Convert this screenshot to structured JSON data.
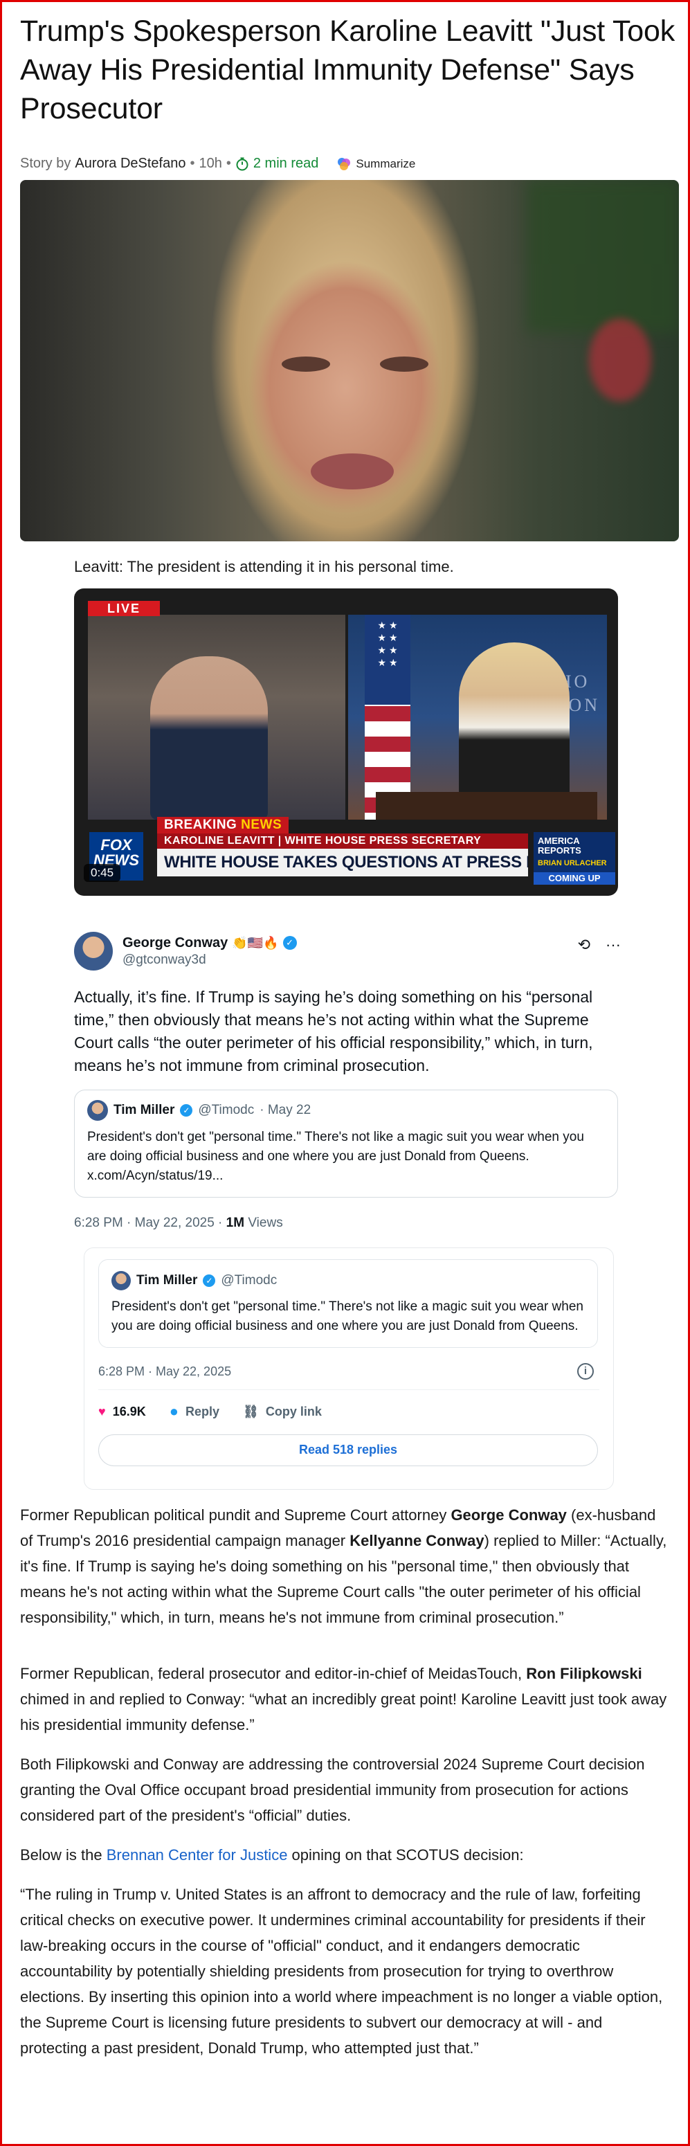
{
  "article": {
    "headline": "Trump's Spokesperson Karoline Leavitt \"Just Took Away His Presidential Immunity Defense\" Says Prosecutor",
    "byline_prefix": "Story by",
    "author": "Aurora DeStefano",
    "time_ago": "10h",
    "read_time": "2 min read",
    "summarize_label": "Summarize",
    "caption": "Leavitt: The president is attending it in his personal time."
  },
  "video": {
    "live_label": "LIVE",
    "network_logo": "FOX NEWS",
    "breaking_word1": "BREAKING",
    "breaking_word2": "NEWS",
    "name_bar": "KAROLINE LEAVITT | WHITE HOUSE PRESS SECRETARY",
    "headline_bar": "WHITE HOUSE TAKES QUESTIONS AT PRESS BRIEFING",
    "promo_title": "AMERICA REPORTS",
    "promo_name": "BRIAN URLACHER",
    "promo_coming": "COMING UP",
    "duration": "0:45",
    "wall_text": "TE HO\nNGTON"
  },
  "tweet": {
    "name": "George Conway",
    "emojis": "👏🇺🇸🔥",
    "handle": "@gtconway3d",
    "text": "Actually, it’s fine. If Trump is saying he’s doing something on his “personal time,” then obviously that means he’s not acting within what the Supreme Court calls “the outer perimeter of his official responsibility,” which, in turn, means he’s not immune from criminal prosecution.",
    "quote": {
      "name": "Tim Miller",
      "handle": "@Timodc",
      "date": "· May 22",
      "text": "President's don't get \"personal time.\" There's not like a magic suit you wear when you are doing official business and one where you are just Donald from Queens. x.com/Acyn/status/19..."
    },
    "time": "6:28 PM · May 22, 2025 · ",
    "views_count": "1M",
    "views_label": " Views"
  },
  "embed": {
    "name": "Tim Miller",
    "handle": "@Timodc",
    "text": "President's don't get \"personal time.\" There's not like a magic suit you wear when you are doing official business and one where you are just Donald from Queens.",
    "date": "6:28 PM · May 22, 2025",
    "likes": "16.9K",
    "reply_label": "Reply",
    "copy_label": "Copy link",
    "read_replies": "Read 518 replies"
  },
  "body": {
    "p1_a": "Former Republican political pundit and Supreme Court attorney ",
    "p1_b": "George Conway",
    "p1_c": " (ex-husband of Trump's 2016 presidential campaign manager ",
    "p1_d": "Kellyanne Conway",
    "p1_e": ") replied to Miller: “Actually, it's fine. If Trump is saying he's doing something on his \"personal time,\" then obviously that means he's not acting within what the Supreme Court calls \"the outer perimeter of his official responsibility,\" which, in turn, means he's not immune from criminal prosecution.”",
    "p2_a": "Former Republican, federal prosecutor and editor-in-chief of MeidasTouch, ",
    "p2_b": "Ron Filipkowski",
    "p2_c": " chimed in and replied to Conway: “what an incredibly great point! Karoline Leavitt just took away his presidential immunity defense.”",
    "p3": "Both Filipkowski and Conway are addressing the controversial 2024 Supreme Court decision granting the Oval Office occupant broad presidential immunity from prosecution for actions considered part of the president's “official” duties.",
    "p4_a": "Below is the ",
    "p4_link": "Brennan Center for Justice",
    "p4_b": " opining on that SCOTUS decision:",
    "p5": "“The ruling in Trump v. United States is an affront to democracy and the rule of law, forfeiting critical checks on executive power. It undermines criminal accountability for presidents if their law-breaking occurs in the course of \"official\" conduct, and it endangers democratic accountability by potentially shielding presidents from prosecution for trying to overthrow elections. By inserting this opinion into a world where impeachment is no longer a viable option, the Supreme Court is licensing future presidents to subvert our democracy at will - and protecting a past president, Donald Trump, who attempted just that.”"
  },
  "colors": {
    "frame_border": "#e00000",
    "read_time": "#138a36",
    "verified": "#1d9bf0",
    "like": "#f91880",
    "link": "#1762c9"
  }
}
